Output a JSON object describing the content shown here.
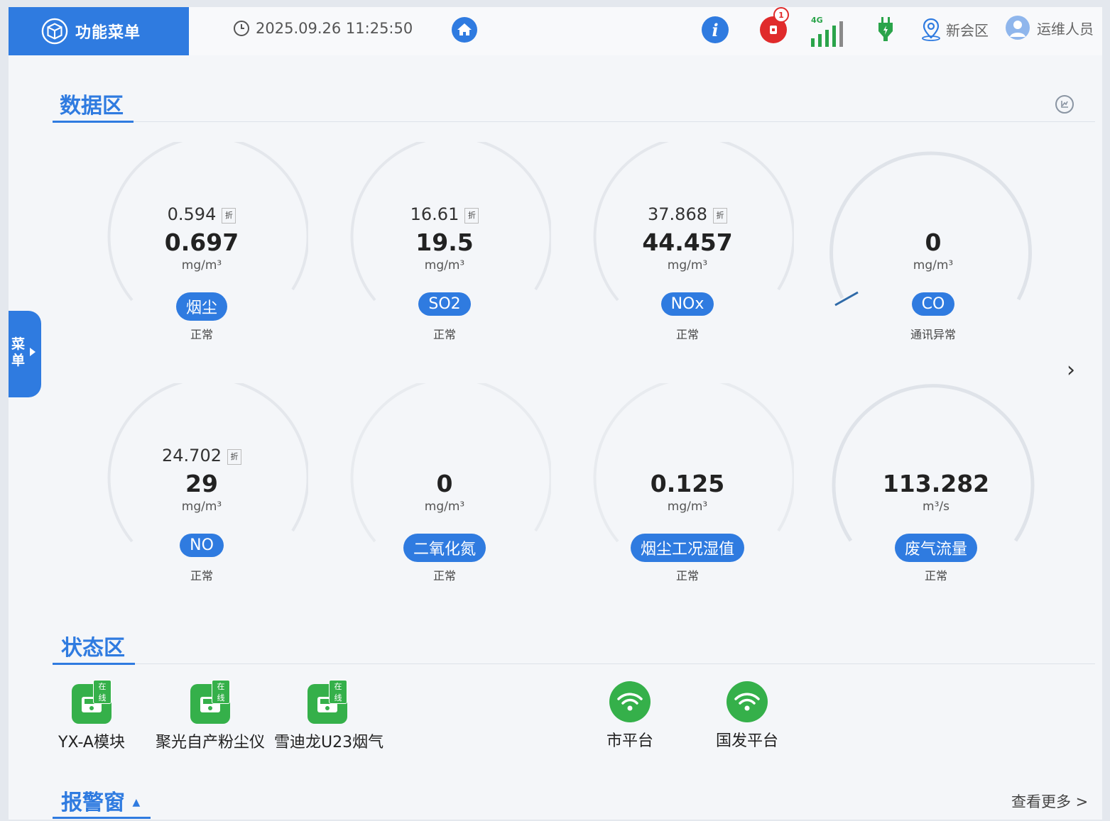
{
  "header": {
    "menu_title": "功能菜单",
    "datetime": "2025.09.26 11:25:50",
    "alarm_count": "1",
    "signal_label": "4G",
    "region": "新会区",
    "user": "运维人员"
  },
  "data_area": {
    "title": "数据区"
  },
  "side_tab": {
    "label": "菜单"
  },
  "gauges": [
    {
      "sub_value": "0.594",
      "sub_tag": "折",
      "value": "0.697",
      "unit": "mg/m³",
      "name": "烟尘",
      "status": "正常"
    },
    {
      "sub_value": "16.61",
      "sub_tag": "折",
      "value": "19.5",
      "unit": "mg/m³",
      "name": "SO2",
      "status": "正常"
    },
    {
      "sub_value": "37.868",
      "sub_tag": "折",
      "value": "44.457",
      "unit": "mg/m³",
      "name": "NOx",
      "status": "正常"
    },
    {
      "sub_value": "",
      "sub_tag": "",
      "value": "0",
      "unit": "mg/m³",
      "name": "CO",
      "status": "通讯异常"
    },
    {
      "sub_value": "24.702",
      "sub_tag": "折",
      "value": "29",
      "unit": "mg/m³",
      "name": "NO",
      "status": "正常"
    },
    {
      "sub_value": "",
      "sub_tag": "",
      "value": "0",
      "unit": "mg/m³",
      "name": "二氧化氮",
      "status": "正常"
    },
    {
      "sub_value": "",
      "sub_tag": "",
      "value": "0.125",
      "unit": "mg/m³",
      "name": "烟尘工况湿值",
      "status": "正常"
    },
    {
      "sub_value": "",
      "sub_tag": "",
      "value": "113.282",
      "unit": "m³/s",
      "name": "废气流量",
      "status": "正常"
    }
  ],
  "status_area": {
    "title": "状态区",
    "devices": [
      {
        "label": "YX-A模块",
        "badge": "在线"
      },
      {
        "label": "聚光自产粉尘仪",
        "badge": "在线"
      },
      {
        "label": "雪迪龙U23烟气",
        "badge": "在线"
      }
    ],
    "platforms": [
      {
        "label": "市平台"
      },
      {
        "label": "国发平台"
      }
    ]
  },
  "alarm_area": {
    "title": "报警窗",
    "more": "查看更多 >"
  },
  "colors": {
    "accent": "#2f7be0",
    "online_green": "#35b04a",
    "alarm_red": "#e02b2b"
  }
}
